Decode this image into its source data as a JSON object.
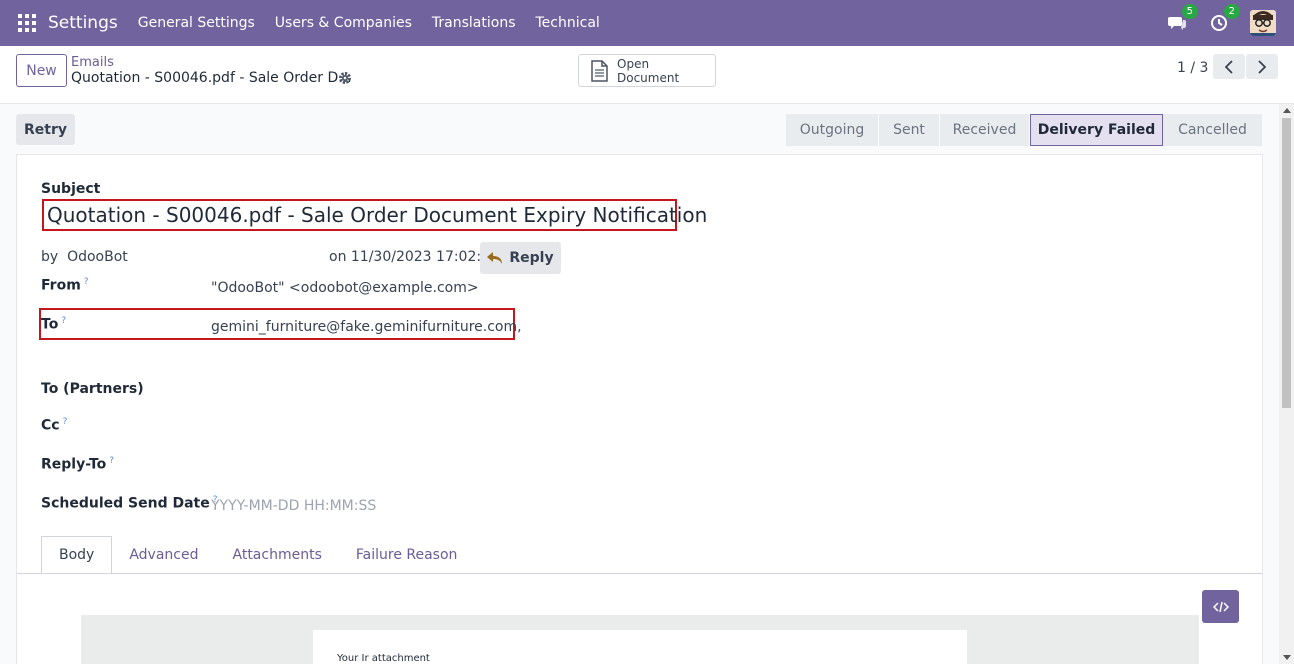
{
  "navbar": {
    "brand": "Settings",
    "links": [
      "General Settings",
      "Users & Companies",
      "Translations",
      "Technical"
    ],
    "chat_badge": "5",
    "activity_badge": "2"
  },
  "control": {
    "new_label": "New",
    "breadcrumb": "Emails",
    "record_title": "Quotation - S00046.pdf - Sale Order D...",
    "open_document_label": "Open Document",
    "pager": "1 / 3"
  },
  "statusbar": {
    "retry_label": "Retry",
    "stages": [
      "Outgoing",
      "Sent",
      "Received",
      "Delivery Failed",
      "Cancelled"
    ],
    "active_stage": "Delivery Failed"
  },
  "form": {
    "subject_label": "Subject",
    "subject_value": "Quotation - S00046.pdf - Sale Order Document Expiry Notification",
    "by_prefix": "by",
    "author": "OdooBot",
    "date_line": "on 11/30/2023 17:02:26",
    "reply_label": "Reply",
    "from_label": "From",
    "from_value": "\"OdooBot\" <odoobot@example.com>",
    "to_label": "To",
    "to_value": "gemini_furniture@fake.geminifurniture.com,",
    "to_partners_label": "To (Partners)",
    "cc_label": "Cc",
    "reply_to_label": "Reply-To",
    "scheduled_label": "Scheduled Send Date",
    "scheduled_placeholder": "YYYY-MM-DD HH:MM:SS",
    "help_mark": "?"
  },
  "tabs": [
    "Body",
    "Advanced",
    "Attachments",
    "Failure Reason"
  ],
  "body": {
    "preview_text": "Your Ir attachment"
  },
  "colors": {
    "brand": "#71639e",
    "highlight": "#c4161c",
    "badge": "#28a745"
  }
}
